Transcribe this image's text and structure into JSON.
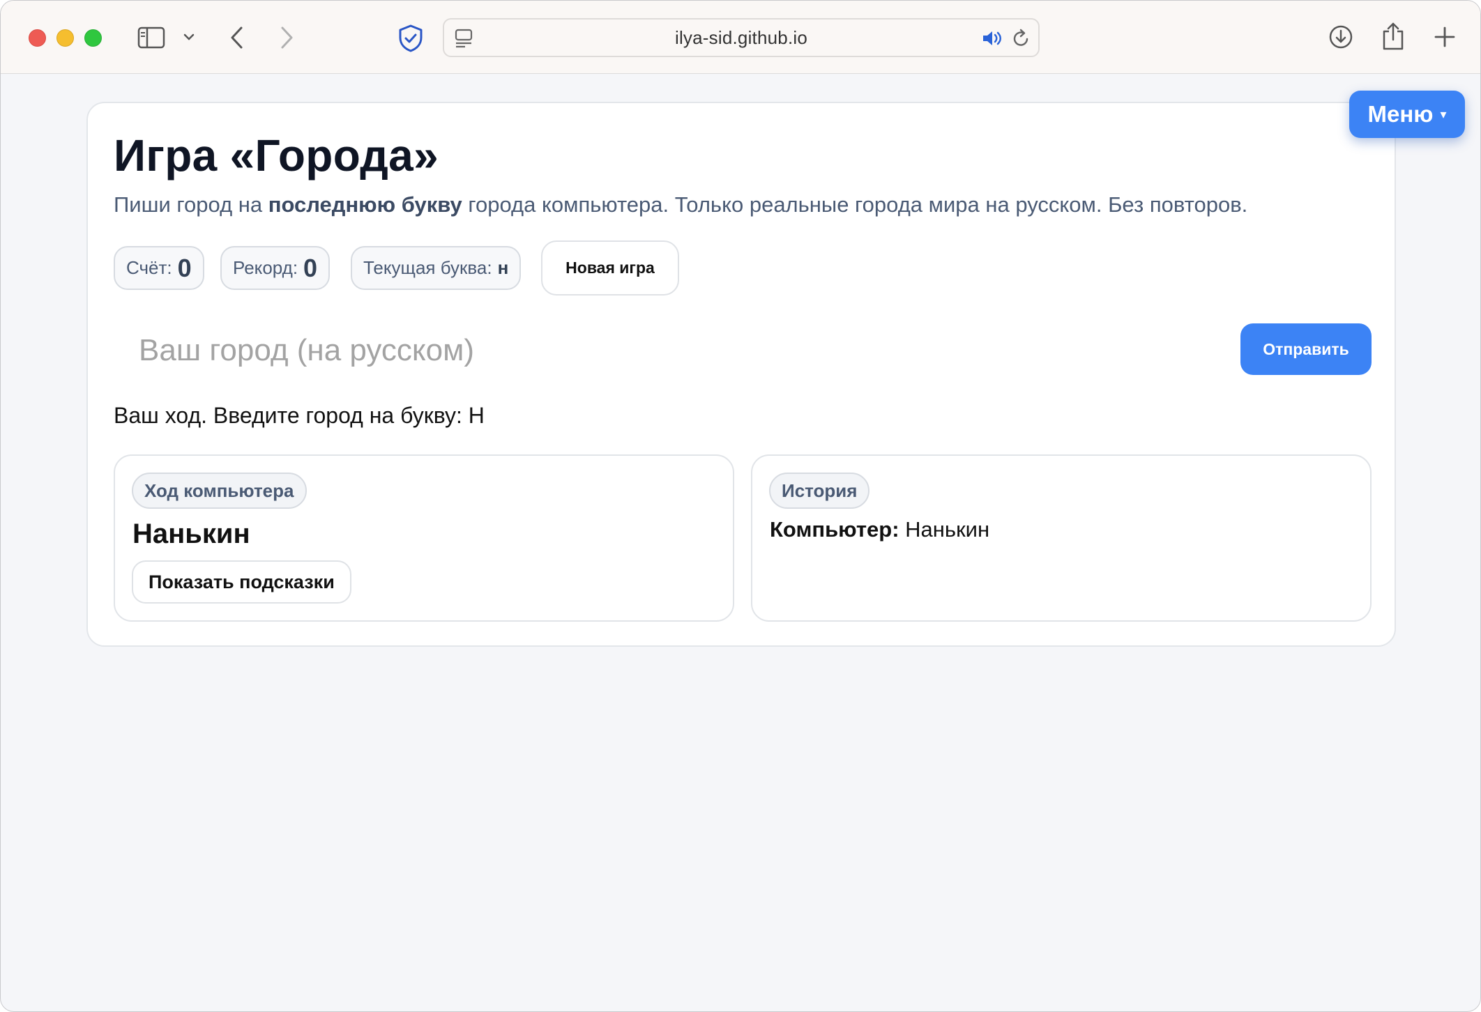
{
  "browser": {
    "url": "ilya-sid.github.io"
  },
  "menu": {
    "label": "Меню",
    "caret": "▾"
  },
  "game": {
    "title": "Игра «Города»",
    "subtitle_before": "Пиши город на ",
    "subtitle_bold": "последнюю букву",
    "subtitle_after": " города компьютера. Только реальные города мира на русском. Без повторов.",
    "score_label": "Счёт:",
    "score": "0",
    "record_label": "Рекорд:",
    "record": "0",
    "letter_label": "Текущая буква:",
    "letter": "н",
    "new_game": "Новая игра",
    "input_placeholder": "Ваш город (на русском)",
    "input_value": "",
    "send": "Отправить",
    "status": "Ваш ход. Введите город на букву: Н"
  },
  "computer_panel": {
    "tag": "Ход компьютера",
    "city": "Нанькин",
    "hints_button": "Показать подсказки"
  },
  "history_panel": {
    "tag": "История",
    "entries": [
      {
        "who": "Компьютер:",
        "city": "Нанькин"
      }
    ]
  }
}
